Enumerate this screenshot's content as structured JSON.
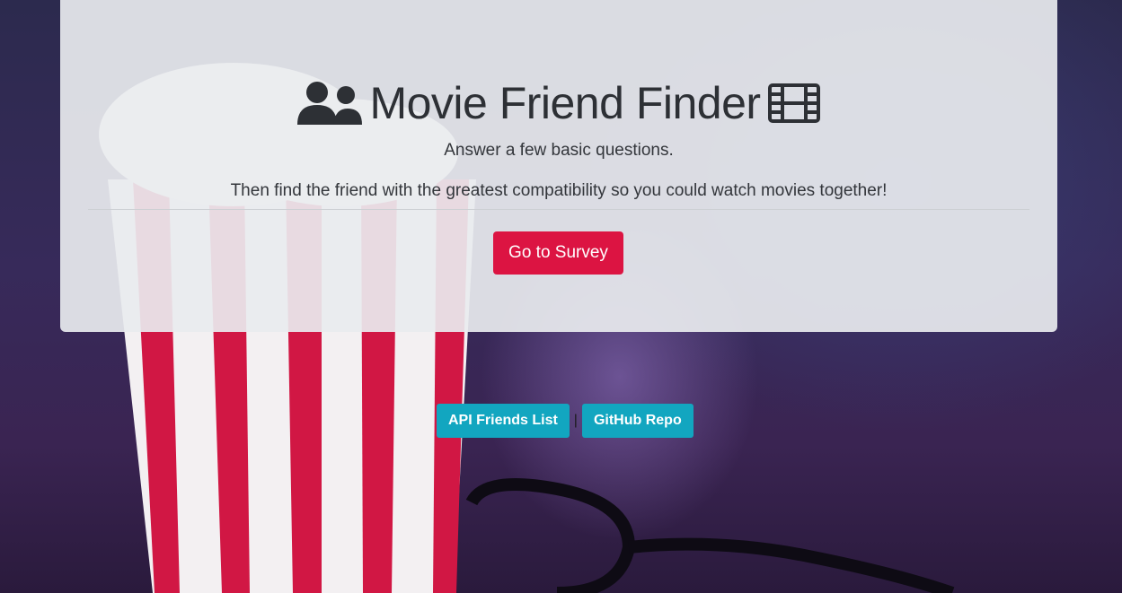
{
  "header": {
    "title": "Movie Friend Finder",
    "icons": [
      "users-icon",
      "film-icon"
    ]
  },
  "intro": {
    "line1": "Answer a few basic questions.",
    "line2": "Then find the friend with the greatest compatibility so you could watch movies together!"
  },
  "actions": {
    "survey_label": "Go to Survey"
  },
  "footer_links": {
    "api_label": "API Friends List",
    "separator": "|",
    "github_label": "GitHub Repo"
  },
  "colors": {
    "primary_button": "#dc1442",
    "info_button": "#12a6c0",
    "panel": "#e9ecef"
  }
}
